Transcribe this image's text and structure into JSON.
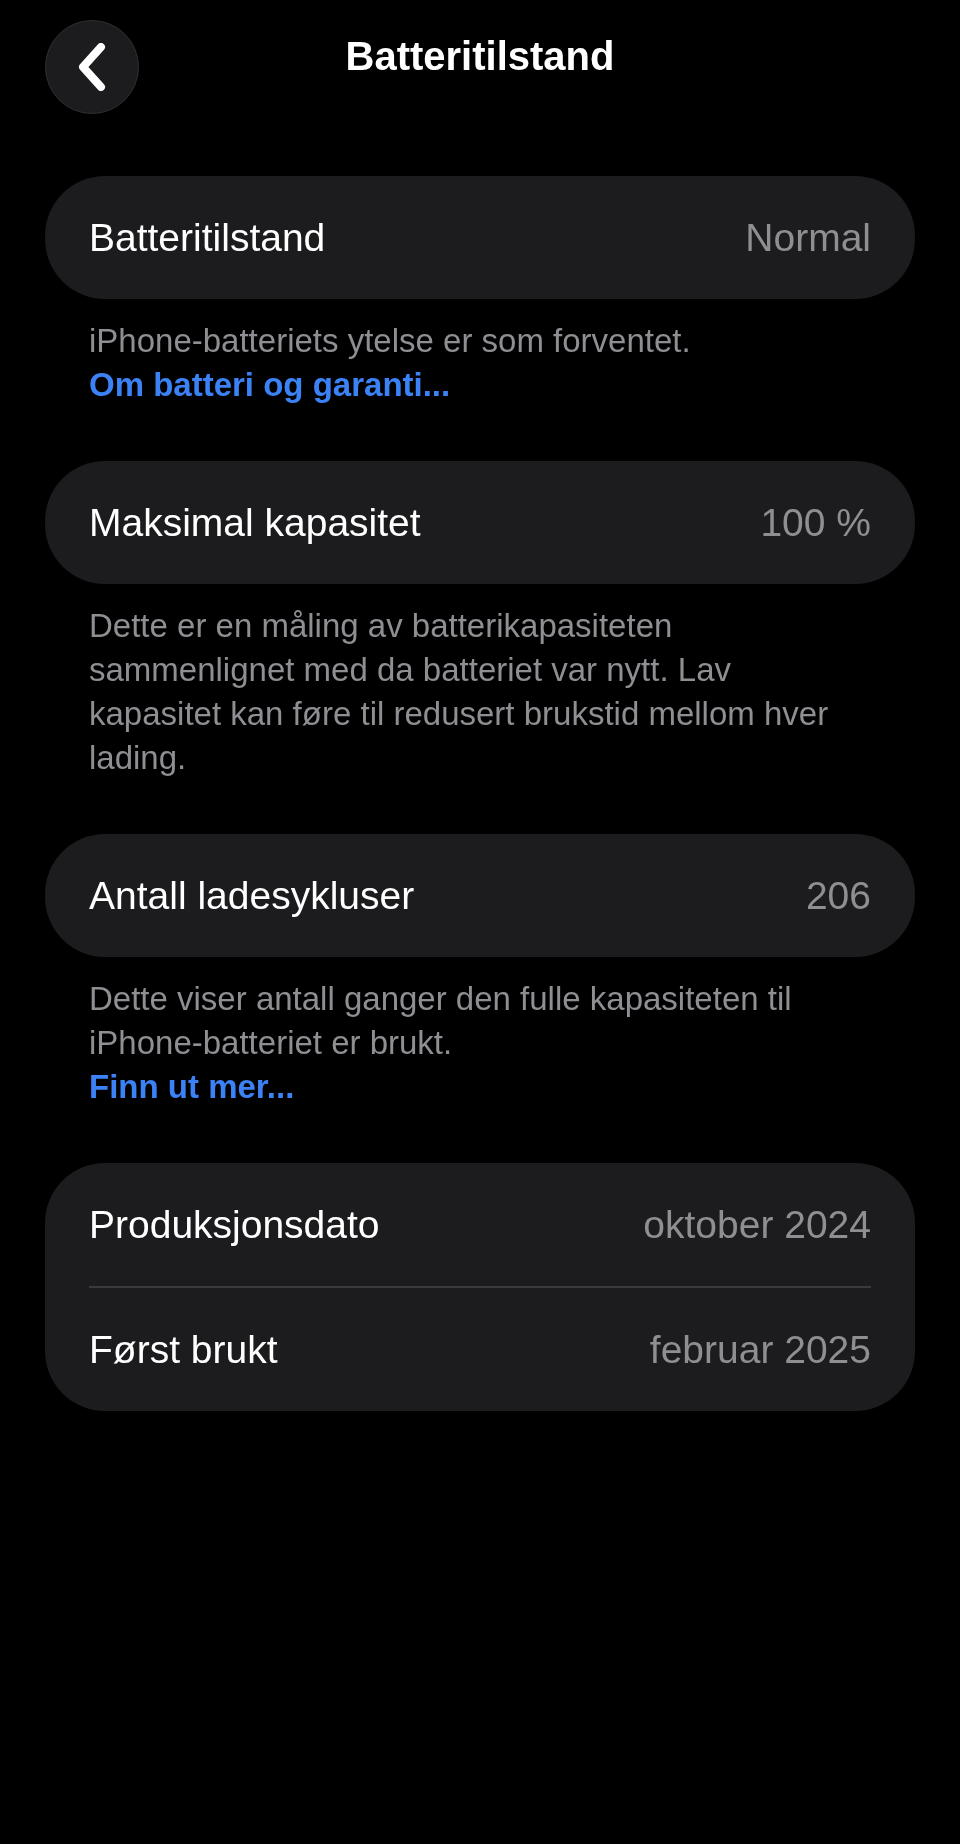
{
  "header": {
    "title": "Batteritilstand"
  },
  "sections": [
    {
      "rows": [
        {
          "label": "Batteritilstand",
          "value": "Normal"
        }
      ],
      "footer": {
        "text": "iPhone-batteriets ytelse er som forventet.",
        "link": "Om batteri og garanti..."
      }
    },
    {
      "rows": [
        {
          "label": "Maksimal kapasitet",
          "value": "100 %"
        }
      ],
      "footer": {
        "text": "Dette er en måling av batterikapasiteten sammenlignet med da batteriet var nytt. Lav kapasitet kan føre til redusert brukstid mellom hver lading."
      }
    },
    {
      "rows": [
        {
          "label": "Antall ladesykluser",
          "value": "206"
        }
      ],
      "footer": {
        "text": "Dette viser antall ganger den fulle kapasiteten til iPhone-batteriet er brukt.",
        "link": "Finn ut mer..."
      }
    },
    {
      "rows": [
        {
          "label": "Produksjonsdato",
          "value": "oktober 2024"
        },
        {
          "label": "Først brukt",
          "value": "februar 2025"
        }
      ]
    }
  ]
}
